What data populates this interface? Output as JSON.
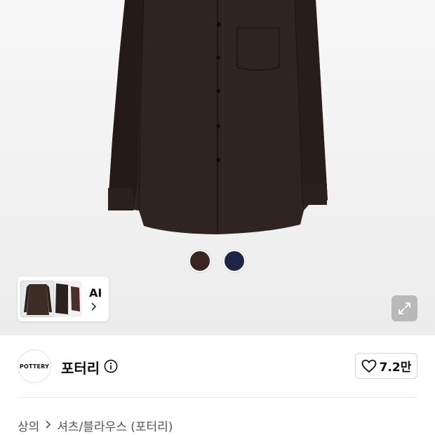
{
  "product": {
    "colors": [
      {
        "name": "brown",
        "hex": "#3a2620"
      },
      {
        "name": "navy",
        "hex": "#1f2547"
      }
    ],
    "ai_label": "AI",
    "expand_icon": "expand-icon"
  },
  "brand": {
    "logo_text": "POTTERY",
    "name": "포터리",
    "info_icon": "info-icon"
  },
  "like": {
    "icon": "heart-icon",
    "count": "7.2만"
  },
  "breadcrumb": {
    "category": "상의",
    "separator_icon": "chevron-right-icon",
    "subcategory": "셔츠/블라우스 (포터리)"
  }
}
